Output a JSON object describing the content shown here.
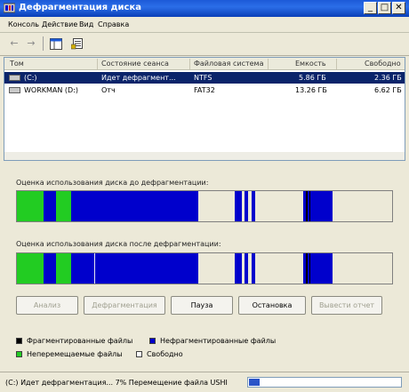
{
  "window": {
    "title": "Дефрагментация диска",
    "min_label": "_",
    "max_label": "□",
    "close_label": "✕"
  },
  "menu": [
    "Консоль",
    "Действие",
    "Вид",
    "Справка"
  ],
  "toolbar": {
    "back_icon": "←",
    "forward_icon": "→"
  },
  "list": {
    "columns": [
      "Том",
      "Состояние сеанса",
      "Файловая система",
      "Емкость",
      "Свободно"
    ],
    "rows": [
      {
        "volume": "(C:)",
        "status": "Идет дефрагмент...",
        "fs": "NTFS",
        "capacity": "5.86 ГБ",
        "free": "2.36 ГБ"
      },
      {
        "volume": "WORKMAN (D:)",
        "status": "Отч",
        "fs": "FAT32",
        "capacity": "13.26 ГБ",
        "free": "6.62 ГБ"
      }
    ]
  },
  "analysis": {
    "before_label": "Оценка использования диска до дефрагментации:",
    "after_label": "Оценка использования диска после дефрагментации:"
  },
  "buttons": {
    "analyze": "Анализ",
    "defrag": "Дефрагментация",
    "pause": "Пауза",
    "stop": "Остановка",
    "report": "Вывести отчет"
  },
  "legend": {
    "fragmented": "Фрагментированные файлы",
    "contiguous": "Нефрагментированные файлы",
    "unmovable": "Неперемещаемые файлы",
    "free": "Свободно"
  },
  "colors": {
    "fragmented": "#000000",
    "contiguous": "#0000cc",
    "unmovable": "#22cc22",
    "free": "#ffffff"
  },
  "status": {
    "text": "(C:) Идет дефрагментация... 7% Перемещение файла USHI",
    "progress_percent": 7
  }
}
